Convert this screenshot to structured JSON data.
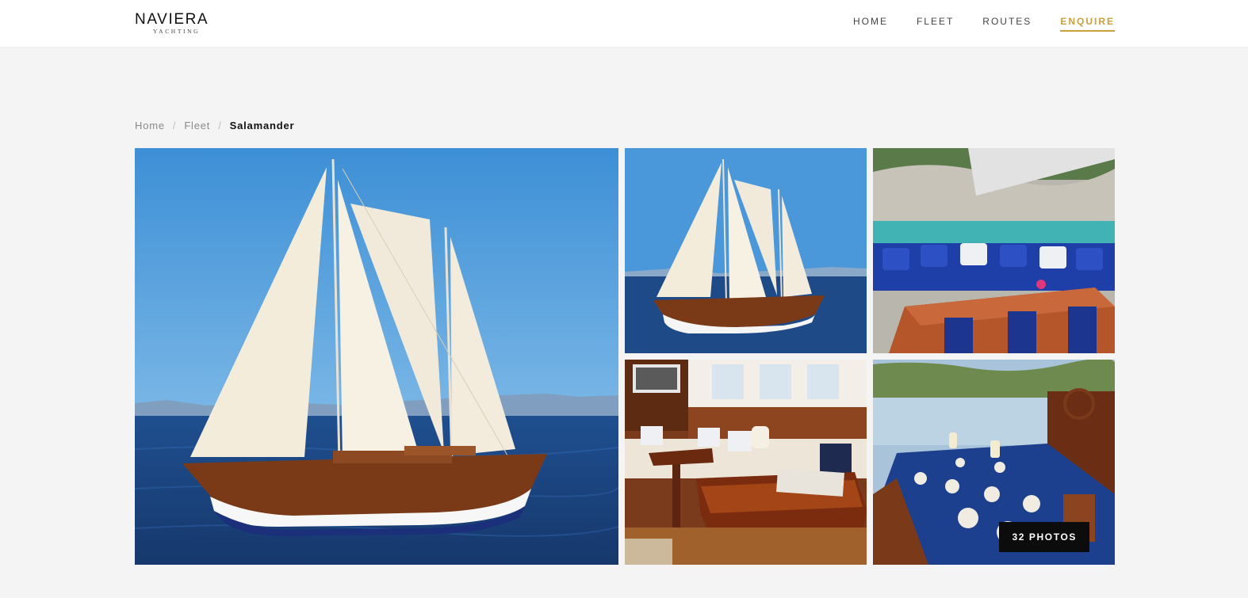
{
  "brand": {
    "name": "NAVIERA",
    "tagline": "YACHTING"
  },
  "nav": {
    "items": [
      "HOME",
      "FLEET",
      "ROUTES",
      "ENQUIRE"
    ],
    "active": "ENQUIRE"
  },
  "breadcrumb": {
    "home": "Home",
    "fleet": "Fleet",
    "current": "Salamander",
    "separator": "/"
  },
  "gallery": {
    "photos_label": "32 PHOTOS",
    "images": [
      {
        "subject": "gulet-under-sail-main"
      },
      {
        "subject": "gulet-under-sail-distance"
      },
      {
        "subject": "deck-lounge-blue-cushions"
      },
      {
        "subject": "saloon-interior"
      },
      {
        "subject": "deck-dining-table"
      }
    ]
  },
  "colors": {
    "accent": "#c9a13b",
    "background": "#f4f4f4",
    "header": "#ffffff",
    "badge": "#0c0c0c"
  }
}
